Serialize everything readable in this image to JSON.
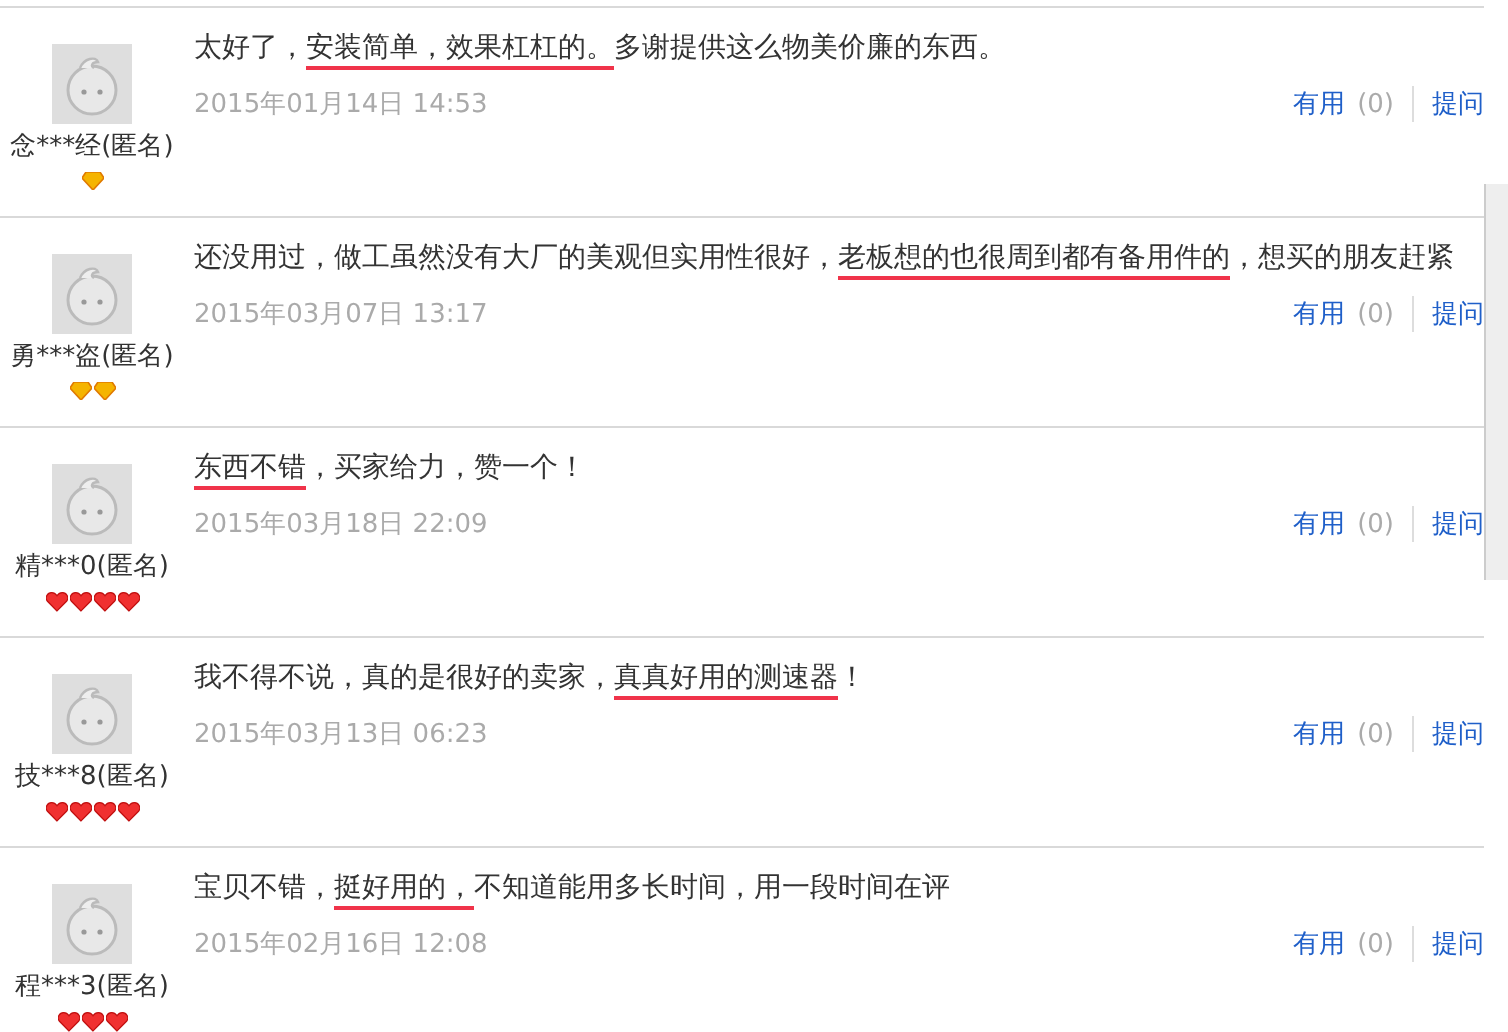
{
  "reviews": [
    {
      "user": "念***经(匿名)",
      "badges": [
        {
          "kind": "diamond"
        }
      ],
      "comment": [
        {
          "text": "太好了，",
          "underlined": false
        },
        {
          "text": "安装简单，效果杠杠的。",
          "underlined": true
        },
        {
          "text": "多谢提供这么物美价廉的东西。",
          "underlined": false
        }
      ],
      "date": "2015年01月14日 14:53",
      "useful_label": "有用",
      "useful_count": "(0)",
      "ask": "提问"
    },
    {
      "user": "勇***盗(匿名)",
      "badges": [
        {
          "kind": "diamond"
        },
        {
          "kind": "diamond"
        }
      ],
      "comment": [
        {
          "text": "还没用过，做工虽然没有大厂的美观但实用性很好，",
          "underlined": false
        },
        {
          "text": "老板想的也很周到都有备用件的",
          "underlined": true
        },
        {
          "text": "，想买的朋友赶紧",
          "underlined": false
        }
      ],
      "date": "2015年03月07日 13:17",
      "useful_label": "有用",
      "useful_count": "(0)",
      "ask": "提问"
    },
    {
      "user": "精***0(匿名)",
      "badges": [
        {
          "kind": "heart"
        },
        {
          "kind": "heart"
        },
        {
          "kind": "heart"
        },
        {
          "kind": "heart"
        }
      ],
      "comment": [
        {
          "text": "东西不错",
          "underlined": true
        },
        {
          "text": "，买家给力，赞一个！",
          "underlined": false
        }
      ],
      "date": "2015年03月18日 22:09",
      "useful_label": "有用",
      "useful_count": "(0)",
      "ask": "提问"
    },
    {
      "user": "技***8(匿名)",
      "badges": [
        {
          "kind": "heart"
        },
        {
          "kind": "heart"
        },
        {
          "kind": "heart"
        },
        {
          "kind": "heart"
        }
      ],
      "comment": [
        {
          "text": "我不得不说，真的是很好的卖家，",
          "underlined": false
        },
        {
          "text": "真真好用的测速器",
          "underlined": true
        },
        {
          "text": "！",
          "underlined": false
        }
      ],
      "date": "2015年03月13日 06:23",
      "useful_label": "有用",
      "useful_count": "(0)",
      "ask": "提问"
    },
    {
      "user": "程***3(匿名)",
      "badges": [
        {
          "kind": "heart"
        },
        {
          "kind": "heart"
        },
        {
          "kind": "heart"
        }
      ],
      "comment": [
        {
          "text": "宝贝不错，",
          "underlined": false
        },
        {
          "text": "挺好用的，",
          "underlined": true
        },
        {
          "text": "不知道能用多长时间，用一段时间在评",
          "underlined": false
        }
      ],
      "date": "2015年02月16日 12:08",
      "useful_label": "有用",
      "useful_count": "(0)",
      "ask": "提问"
    }
  ]
}
